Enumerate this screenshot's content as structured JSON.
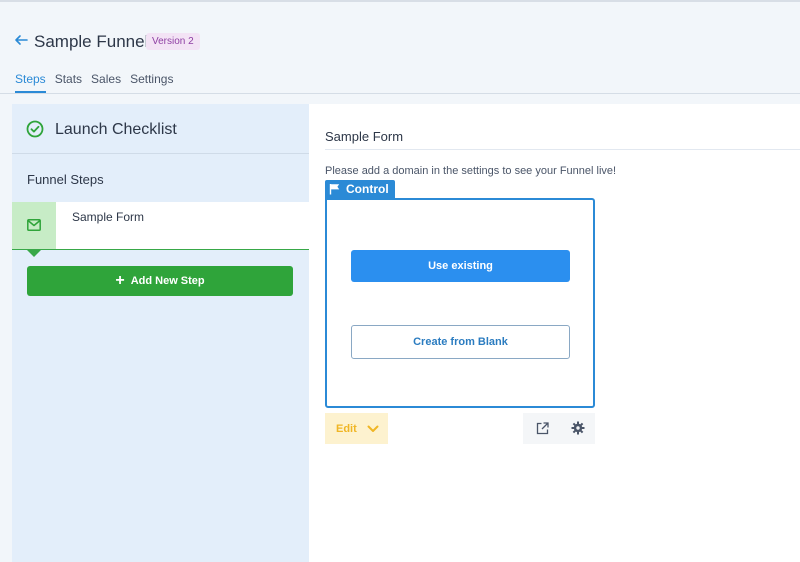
{
  "header": {
    "title": "Sample Funnel",
    "version": "Version 2",
    "tabs": [
      {
        "label": "Steps",
        "active": true
      },
      {
        "label": "Stats",
        "active": false
      },
      {
        "label": "Sales",
        "active": false
      },
      {
        "label": "Settings",
        "active": false
      }
    ]
  },
  "sidebar": {
    "checklist_title": "Launch Checklist",
    "steps_heading": "Funnel Steps",
    "steps": [
      {
        "label": "Sample Form",
        "icon": "mail-icon"
      }
    ],
    "add_step_label": "Add New Step"
  },
  "main": {
    "title": "Sample Form",
    "domain_notice": "Please add a domain in the settings to see your Funnel live!",
    "variant": {
      "tag": "Control",
      "use_existing_label": "Use existing",
      "create_blank_label": "Create from Blank"
    },
    "edit_label": "Edit"
  },
  "colors": {
    "accent_blue": "#2b8ad6",
    "green": "#2fa43a",
    "edit_yellow": "#f0b625",
    "badge_purple": "#8e3fa3"
  }
}
